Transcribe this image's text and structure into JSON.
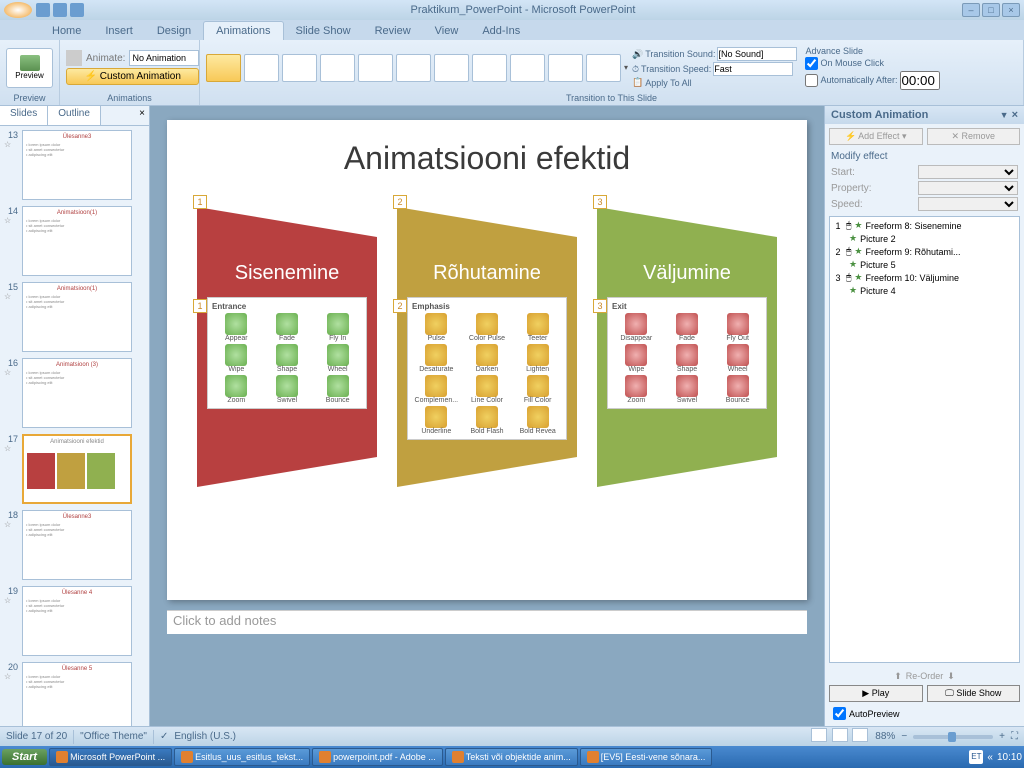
{
  "titlebar": {
    "title": "Praktikum_PowerPoint - Microsoft PowerPoint"
  },
  "tabs": [
    "Home",
    "Insert",
    "Design",
    "Animations",
    "Slide Show",
    "Review",
    "View",
    "Add-Ins"
  ],
  "active_tab": 3,
  "ribbon": {
    "preview": "Preview",
    "animate_label": "Animate:",
    "animate_value": "No Animation",
    "custom_anim": "Custom Animation",
    "group1": "Preview",
    "group2": "Animations",
    "group3": "Transition to This Slide",
    "trans_sound_label": "Transition Sound:",
    "trans_sound_value": "[No Sound]",
    "trans_speed_label": "Transition Speed:",
    "trans_speed_value": "Fast",
    "apply_all": "Apply To All",
    "advance_slide": "Advance Slide",
    "on_mouse_click": "On Mouse Click",
    "auto_after": "Automatically After:",
    "auto_time": "00:00"
  },
  "slide_tabs": {
    "slides": "Slides",
    "outline": "Outline"
  },
  "thumbnails": [
    {
      "num": "13",
      "title": "Ülesanne3"
    },
    {
      "num": "14",
      "title": "Animatsioon(1)"
    },
    {
      "num": "15",
      "title": "Animatsioon(1)"
    },
    {
      "num": "16",
      "title": "Animatsioon (3)"
    },
    {
      "num": "17",
      "title": "Animatsiooni efektid"
    },
    {
      "num": "18",
      "title": "Ülesanne3"
    },
    {
      "num": "19",
      "title": "Ülesanne 4"
    },
    {
      "num": "20",
      "title": "Ülesanne 5"
    }
  ],
  "active_slide": 4,
  "slide": {
    "title": "Animatsiooni efektid",
    "shapes": [
      {
        "label": "Sisenemine",
        "tag": "1",
        "fill": "#b84040",
        "panel_title": "Entrance",
        "effects": [
          "Appear",
          "Fade",
          "Fly In",
          "Wipe",
          "Shape",
          "Wheel",
          "Zoom",
          "Swivel",
          "Bounce"
        ],
        "class": "g"
      },
      {
        "label": "Rõhutamine",
        "tag": "2",
        "fill": "#c0a040",
        "panel_title": "Emphasis",
        "effects": [
          "Pulse",
          "Color Pulse",
          "Teeter",
          "Desaturate",
          "Darken",
          "Lighten",
          "Complemen...",
          "Line Color",
          "Fill Color",
          "Underline",
          "Bold Flash",
          "Bold Revea"
        ],
        "class": "y"
      },
      {
        "label": "Väljumine",
        "tag": "3",
        "fill": "#90b050",
        "panel_title": "Exit",
        "effects": [
          "Disappear",
          "Fade",
          "Fly Out",
          "Wipe",
          "Shape",
          "Wheel",
          "Zoom",
          "Swivel",
          "Bounce"
        ],
        "class": "r"
      }
    ],
    "notes_placeholder": "Click to add notes"
  },
  "anim_pane": {
    "title": "Custom Animation",
    "add_effect": "Add Effect",
    "remove": "Remove",
    "modify": "Modify effect",
    "start": "Start:",
    "property": "Property:",
    "speed": "Speed:",
    "items": [
      {
        "num": "1",
        "label": "Freeform 8: Sisenemine"
      },
      {
        "num": "",
        "label": "Picture 2"
      },
      {
        "num": "2",
        "label": "Freeform 9: Rõhutami..."
      },
      {
        "num": "",
        "label": "Picture 5"
      },
      {
        "num": "3",
        "label": "Freeform 10: Väljumine"
      },
      {
        "num": "",
        "label": "Picture 4"
      }
    ],
    "reorder": "Re-Order",
    "play": "Play",
    "slideshow": "Slide Show",
    "autopreview": "AutoPreview"
  },
  "statusbar": {
    "slide_of": "Slide 17 of 20",
    "theme": "\"Office Theme\"",
    "lang": "English (U.S.)",
    "zoom": "88%"
  },
  "taskbar": {
    "start": "Start",
    "items": [
      "Microsoft PowerPoint ...",
      "Esitlus_uus_esitlus_tekst...",
      "powerpoint.pdf - Adobe ...",
      "Teksti või objektide anim...",
      "[EV5] Eesti-vene sõnara..."
    ],
    "lang": "ET",
    "time": "10:10"
  }
}
